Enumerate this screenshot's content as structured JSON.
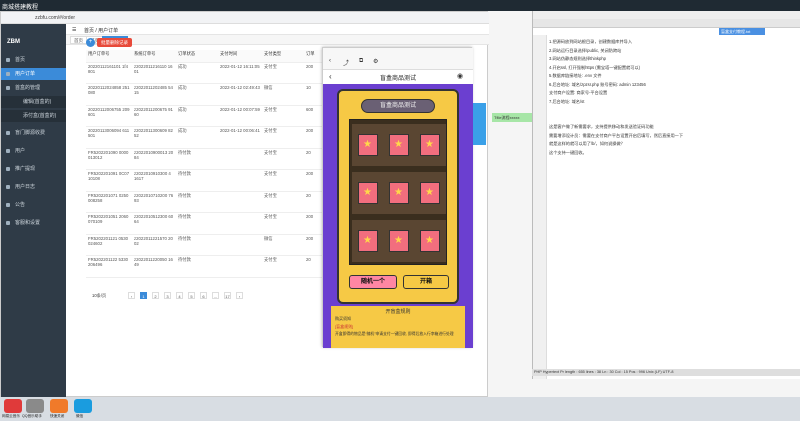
{
  "window_title": "商城搭建教程",
  "browser": {
    "url": "zzbfu.com/#/order",
    "breadcrumb": "首页 / 用户订单",
    "tabs": [
      "首页",
      "首页",
      "用户订单"
    ]
  },
  "sidebar": {
    "logo": "ZBM",
    "items": [
      {
        "label": "首页"
      },
      {
        "label": "用户订单"
      },
      {
        "label": "首盒的管理"
      },
      {
        "label": "编辑(首盒的)"
      },
      {
        "label": "添付盒(首盒的)"
      },
      {
        "label": "盲门脚源收费"
      },
      {
        "label": "用户"
      },
      {
        "label": "推广提现"
      },
      {
        "label": "用户日志"
      },
      {
        "label": "公告"
      },
      {
        "label": "客服和设置"
      }
    ]
  },
  "actions": {
    "add": "+",
    "batch_delete": "批量删除记录"
  },
  "table": {
    "headers": [
      "用户订单号",
      "系统订单号",
      "订单状态",
      "支付时间",
      "支付类型",
      "订单"
    ],
    "rows": [
      [
        "20220112161101 1f4801",
        "z2022011216110 1601",
        "成功",
        "2022-01-12 16:11:05",
        "支付宝",
        "200"
      ],
      [
        "20220112024858 251080",
        "z2022011202485 5415",
        "成功",
        "2022-01-12 02:49:43",
        "微信",
        "10"
      ],
      [
        "20220112006755 209601",
        "z2022011200675 9160",
        "成功",
        "2022-01-12 00:07:59",
        "支付宝",
        "600"
      ],
      [
        "20220113006094 611501",
        "z2022011300609 8252",
        "成功",
        "2022-01-12 00:06:41",
        "支付宝",
        "200"
      ],
      [
        "FR5202201090 0000013012",
        "z2022010900013 2084",
        "待付款",
        "",
        "支付宝",
        "20"
      ],
      [
        "FR5202201091 0C0710108",
        "z2022010910300 4 1617",
        "待付款",
        "",
        "支付宝",
        "200"
      ],
      [
        "FR5202201071 0250008258",
        "z2022010710200 7693",
        "待付款",
        "",
        "支付宝",
        "20"
      ],
      [
        "FR5202201051 2060070109",
        "z2022010512300 6064",
        "待付款",
        "",
        "支付宝",
        "200"
      ],
      [
        "FR5202201121 0530024602",
        "z2022011221570 2002",
        "待付款",
        "",
        "微信",
        "200"
      ],
      [
        "FR5202201122 5330206496",
        "z2022011220050 1649",
        "待付款",
        "",
        "支付宝",
        "20"
      ]
    ]
  },
  "pagination": {
    "size": "10条/页",
    "pages": [
      "1",
      "2",
      "3",
      "4",
      "5",
      "6",
      "...",
      "17"
    ]
  },
  "phone": {
    "title": "盲盒商品测试",
    "sign": "盲盒商品测试",
    "btn_random": "随机一个",
    "btn_open": "开箱",
    "rules_title": "开盲盒规则",
    "rules_sub": "购买须知",
    "rules_tag": "[盲盒规则]",
    "rules_text": "开盒即得的物品是“随机”申请支付一键回收, 即得后放入行李箱进行处理"
  },
  "editor": {
    "tab": "盲盒支付教程.txt",
    "lines": [
      "1.把源码放到网站根目录，创建数据库并导入",
      "2.网站运行目录选择/public, 关闭防跨站",
      "3.网站伪静态规则选择thinkphp",
      "4.开启ssl, 打开强制https (需宝塔一键配置就可以)",
      "5.数据库链接地址: .env 文件",
      "6.后台地址: 域名/zpzsr.php 账号密码: admin  123456",
      "支付商户设置: 商家号-平台设置",
      "7.后台地址: 域名/st",
      "",
      "",
      "这是客户做了新需要求，支持提供移动和发送验证码功能",
      "需要增添设计员：需要在支付商户平台设置开启后填写，然后直接用一下",
      "就是这样的就可以用了/b/，如何说操做？",
      "这个支持一键回收。"
    ],
    "status": "PHP Hypertext Pr length : 655  lines : 38     Ln : 30  Col : 15  Pos : 996     Unix (LF)     UTF-8"
  },
  "taskbar": {
    "labels": [
      "网易云音乐",
      "QQ音乐助手",
      "快速关闭",
      "微信"
    ]
  },
  "green_tag": "Tfile流程xxxxx"
}
